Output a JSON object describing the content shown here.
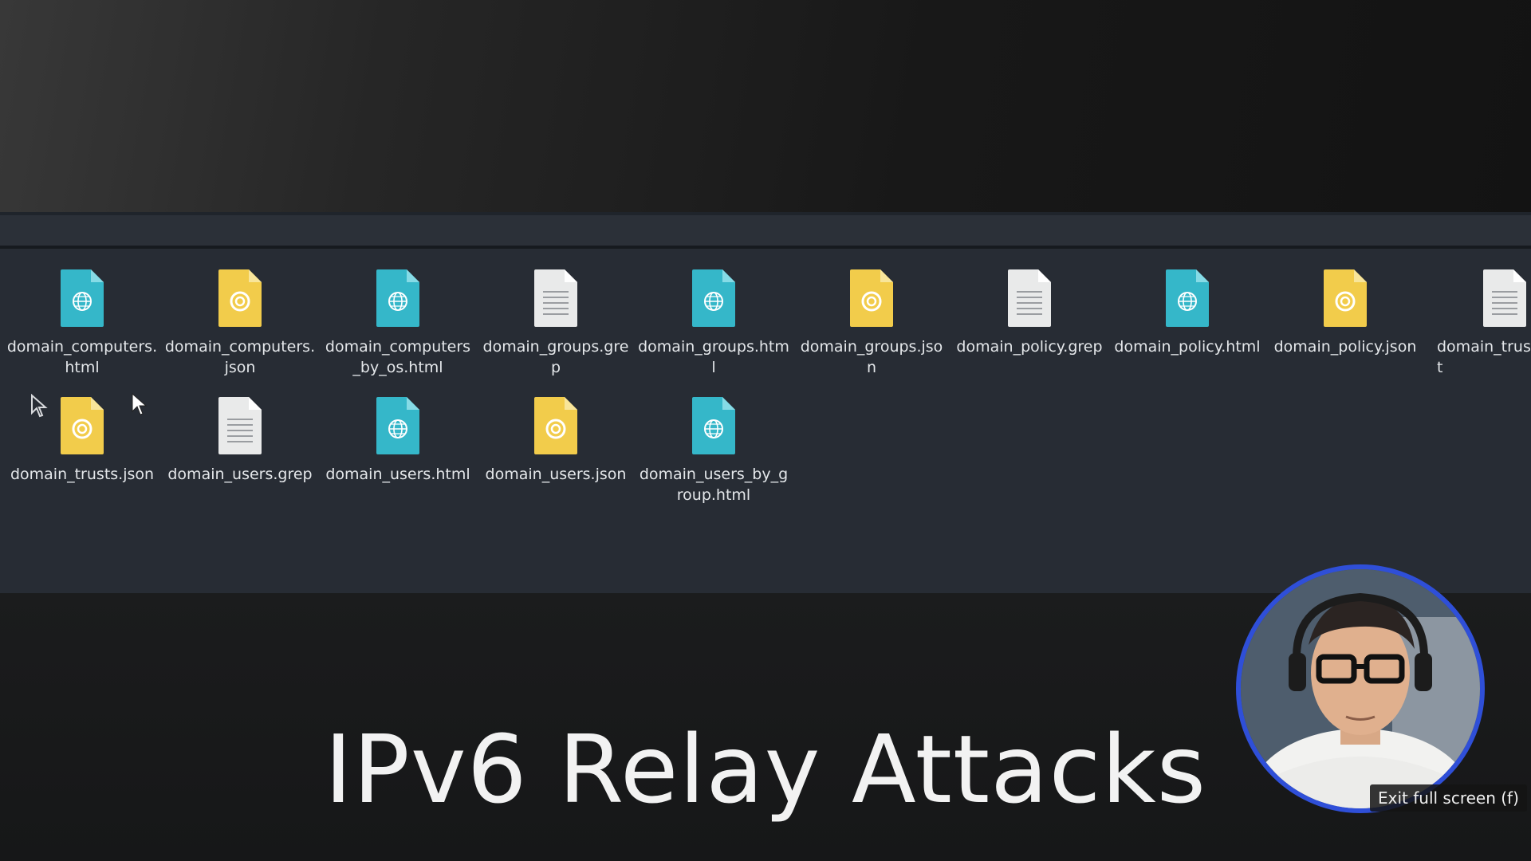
{
  "files": [
    {
      "name": "domain_computers.html",
      "type": "html"
    },
    {
      "name": "domain_computers.json",
      "type": "json"
    },
    {
      "name": "domain_computers_by_os.html",
      "type": "html"
    },
    {
      "name": "domain_groups.grep",
      "type": "grep"
    },
    {
      "name": "domain_groups.html",
      "type": "html"
    },
    {
      "name": "domain_groups.json",
      "type": "json"
    },
    {
      "name": "domain_policy.grep",
      "type": "grep"
    },
    {
      "name": "domain_policy.html",
      "type": "html"
    },
    {
      "name": "domain_policy.json",
      "type": "json"
    },
    {
      "name": "domain_trust",
      "type": "grep"
    },
    {
      "name": "domain_trusts.json",
      "type": "json"
    },
    {
      "name": "domain_users.grep",
      "type": "grep"
    },
    {
      "name": "domain_users.html",
      "type": "html"
    },
    {
      "name": "domain_users.json",
      "type": "json"
    },
    {
      "name": "domain_users_by_group.html",
      "type": "html"
    }
  ],
  "icons": {
    "html": "web-file-icon",
    "json": "json-file-icon",
    "grep": "text-file-icon"
  },
  "colors": {
    "html_icon": "#35b7c9",
    "json_icon": "#f2cc4b",
    "grep_icon": "#e9eaea",
    "webcam_ring": "#2f4fd8"
  },
  "slide": {
    "title": "IPv6 Relay Attacks"
  },
  "player": {
    "tooltip": "Exit full screen (f)"
  }
}
